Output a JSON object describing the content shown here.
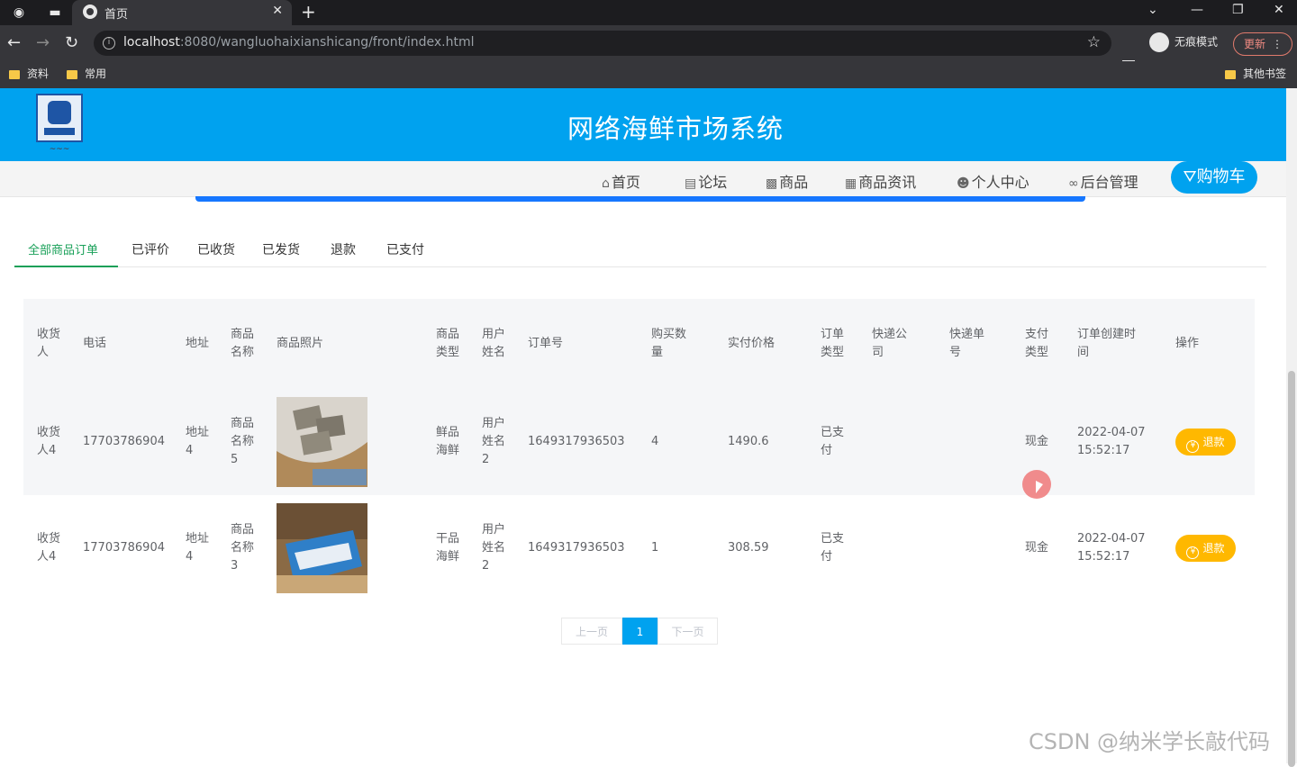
{
  "browser": {
    "tab_title": "首页",
    "url_host": "localhost",
    "url_rest": ":8080/wangluohaixianshicang/front/index.html",
    "incognito_label": "无痕模式",
    "update_label": "更新",
    "bookmarks": [
      "资料",
      "常用"
    ],
    "other_bookmarks": "其他书签"
  },
  "site": {
    "title": "网络海鲜市场系统",
    "nav": [
      "首页",
      "论坛",
      "商品",
      "商品资讯",
      "个人中心",
      "后台管理"
    ],
    "cart_label": "购物车"
  },
  "order_tabs": {
    "items": [
      "全部商品订单",
      "已评价",
      "已收货",
      "已发货",
      "退款",
      "已支付"
    ],
    "active": 0
  },
  "table": {
    "headers": [
      "收货人",
      "电话",
      "地址",
      "商品名称",
      "商品照片",
      "商品类型",
      "用户姓名",
      "订单号",
      "购买数量",
      "实付价格",
      "订单类型",
      "快递公司",
      "快递单号",
      "支付类型",
      "订单创建时间",
      "操作"
    ],
    "rows": [
      {
        "receiver": "收货人4",
        "phone": "17703786904",
        "address": "地址4",
        "product_name": "商品名称5",
        "product_type": "鲜品海鲜",
        "user_name": "用户姓名2",
        "order_no": "1649317936503",
        "qty": "4",
        "price": "1490.6",
        "order_type": "已支付",
        "courier": "",
        "tracking_no": "",
        "pay_type": "现金",
        "created": "2022-04-07 15:52:17",
        "action": "退款"
      },
      {
        "receiver": "收货人4",
        "phone": "17703786904",
        "address": "地址4",
        "product_name": "商品名称3",
        "product_type": "干品海鲜",
        "user_name": "用户姓名2",
        "order_no": "1649317936503",
        "qty": "1",
        "price": "308.59",
        "order_type": "已支付",
        "courier": "",
        "tracking_no": "",
        "pay_type": "现金",
        "created": "2022-04-07 15:52:17",
        "action": "退款"
      }
    ]
  },
  "pagination": {
    "prev": "上一页",
    "current": "1",
    "next": "下一页"
  },
  "watermark": "CSDN @纳米学长敲代码",
  "colors": {
    "header_blue": "#00a2ef",
    "active_tab_green": "#18a058",
    "refund_yellow": "#ffb800"
  }
}
